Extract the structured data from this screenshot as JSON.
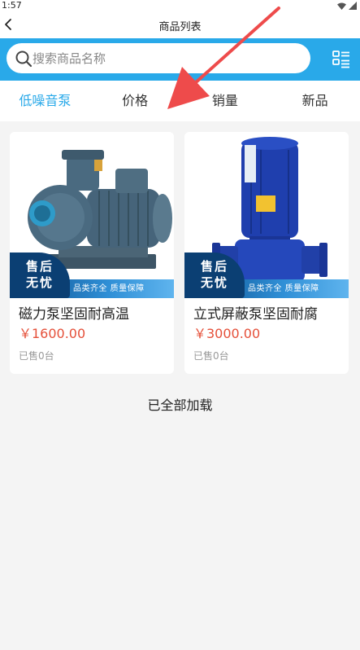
{
  "status_bar": {
    "time": "1:57"
  },
  "header": {
    "title": "商品列表"
  },
  "search": {
    "placeholder": "搜索商品名称"
  },
  "sort_tabs": [
    {
      "label": "低噪音泵",
      "active": true
    },
    {
      "label": "价格",
      "active": false
    },
    {
      "label": "销量",
      "active": false
    },
    {
      "label": "新品",
      "active": false
    }
  ],
  "products": [
    {
      "name": "磁力泵坚固耐高温",
      "price": "￥1600.00",
      "sold": "已售0台",
      "badge_line1": "售后",
      "badge_line2": "无忧",
      "promo": "品类齐全  质量保障"
    },
    {
      "name": "立式屏蔽泵坚固耐腐",
      "price": "￥3000.00",
      "sold": "已售0台",
      "badge_line1": "售后",
      "badge_line2": "无忧",
      "promo": "品类齐全  质量保障"
    }
  ],
  "list_status": "已全部加载",
  "colors": {
    "accent": "#29a9e9",
    "price": "#e5503a",
    "annotation": "#ee4b4b"
  },
  "icons": {
    "back": "chevron-left-icon",
    "search": "search-icon",
    "layout": "grid-list-toggle-icon",
    "wifi": "wifi-icon",
    "signal": "signal-icon"
  }
}
